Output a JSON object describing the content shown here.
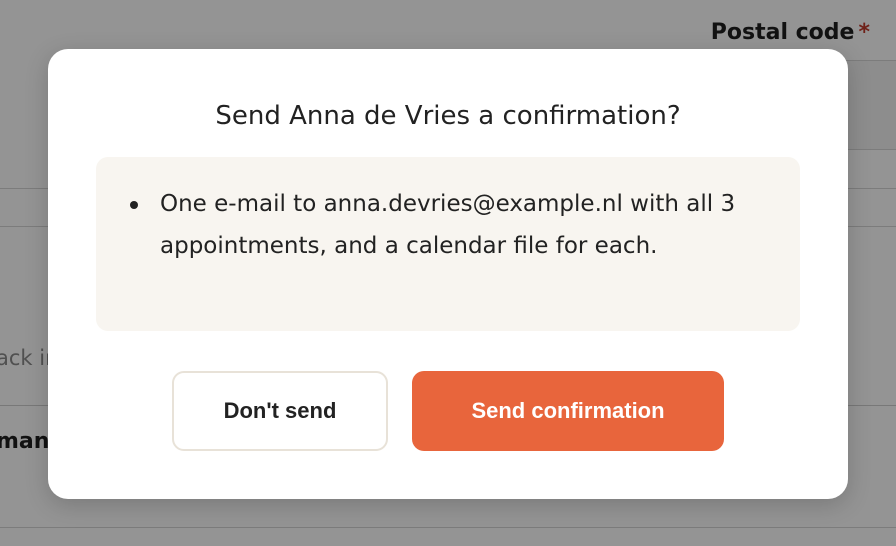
{
  "background": {
    "field_label": "Postal code",
    "required_marker": "*",
    "left_text_1": "ack in",
    "left_text_2": "mand"
  },
  "modal": {
    "title": "Send Anna de Vries a confirmation?",
    "info_items": [
      "One e-mail to anna.devries@example.nl with all 3 appointments, and a calendar file for each."
    ],
    "buttons": {
      "cancel_label": "Don't send",
      "confirm_label": "Send confirmation"
    }
  },
  "colors": {
    "accent": "#e8653c",
    "info_background": "#f8f5f0",
    "required": "#c0392b"
  }
}
